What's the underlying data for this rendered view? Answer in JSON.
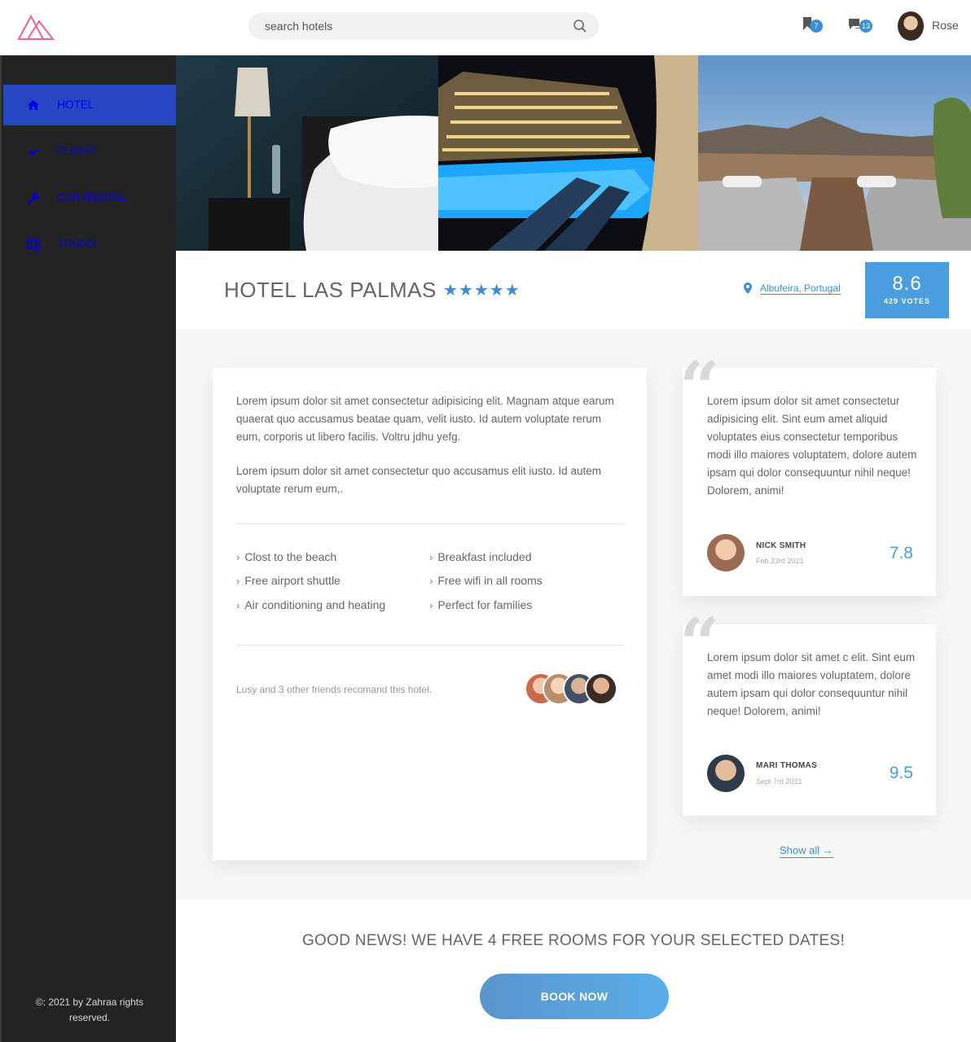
{
  "app": {
    "logo_name": "logo-icon"
  },
  "search": {
    "placeholder": "search hotels"
  },
  "header": {
    "bookmarks_badge": "7",
    "messages_badge": "13",
    "user_name": "Rose"
  },
  "sidebar": {
    "items": [
      {
        "label": "HOTEL",
        "icon": "home-icon",
        "active": true
      },
      {
        "label": "FLIGHT",
        "icon": "plane-icon",
        "active": false
      },
      {
        "label": "CAR RENTAL",
        "icon": "wrench-icon",
        "active": false
      },
      {
        "label": "TOURS",
        "icon": "map-icon",
        "active": false
      }
    ],
    "copyright": "©: 2021 by Zahraa rights reserved."
  },
  "hotel": {
    "name": "HOTEL LAS PALMAS",
    "stars": "★★★★★",
    "star_count": 5,
    "location": "Albufeira, Portugal",
    "score": "8.6",
    "votes": "429 VOTES"
  },
  "description": {
    "p1": "Lorem ipsum dolor sit amet consectetur adipisicing elit. Magnam atque earum quaerat quo accusamus beatae quam, velit iusto. Id autem voluptate rerum eum, corporis ut libero facilis. Voltru jdhu yefg.",
    "p2": "Lorem ipsum dolor sit amet consectetur quo accusamus elit iusto. Id autem voluptate rerum eum,."
  },
  "features": [
    "Clost to the beach",
    "Breakfast included",
    "Free airport shuttle",
    "Free wifi in all rooms",
    "Air conditioning and heating",
    "Perfect for families"
  ],
  "friends": {
    "text": "Lusy and 3 other friends recomand this hotel."
  },
  "reviews": [
    {
      "text": "Lorem ipsum dolor sit amet consectetur adipisicing elit. Sint eum amet aliquid voluptates eius consectetur temporibus modi illo maiores voluptatem, dolore autem ipsam qui dolor consequuntur nihil neque! Dolorem, animi!",
      "name": "NICK SMITH",
      "date": "Feb 23rd 2021",
      "score": "7.8"
    },
    {
      "text": "Lorem ipsum dolor sit amet c elit. Sint eum amet modi illo maiores voluptatem, dolore autem ipsam qui dolor consequuntur nihil neque! Dolorem, animi!",
      "name": "MARI THOMAS",
      "date": "Sept 7rd 2021",
      "score": "9.5"
    }
  ],
  "show_all": "Show all",
  "cta": {
    "message": "GOOD NEWS! WE HAVE 4 FREE ROOMS FOR YOUR SELECTED DATES!",
    "button": "BOOK NOW"
  },
  "colors": {
    "accent": "#3b8fd9",
    "sidebar_bg": "#232323",
    "sidebar_active": "#2746c2",
    "logo": "#f06292"
  }
}
